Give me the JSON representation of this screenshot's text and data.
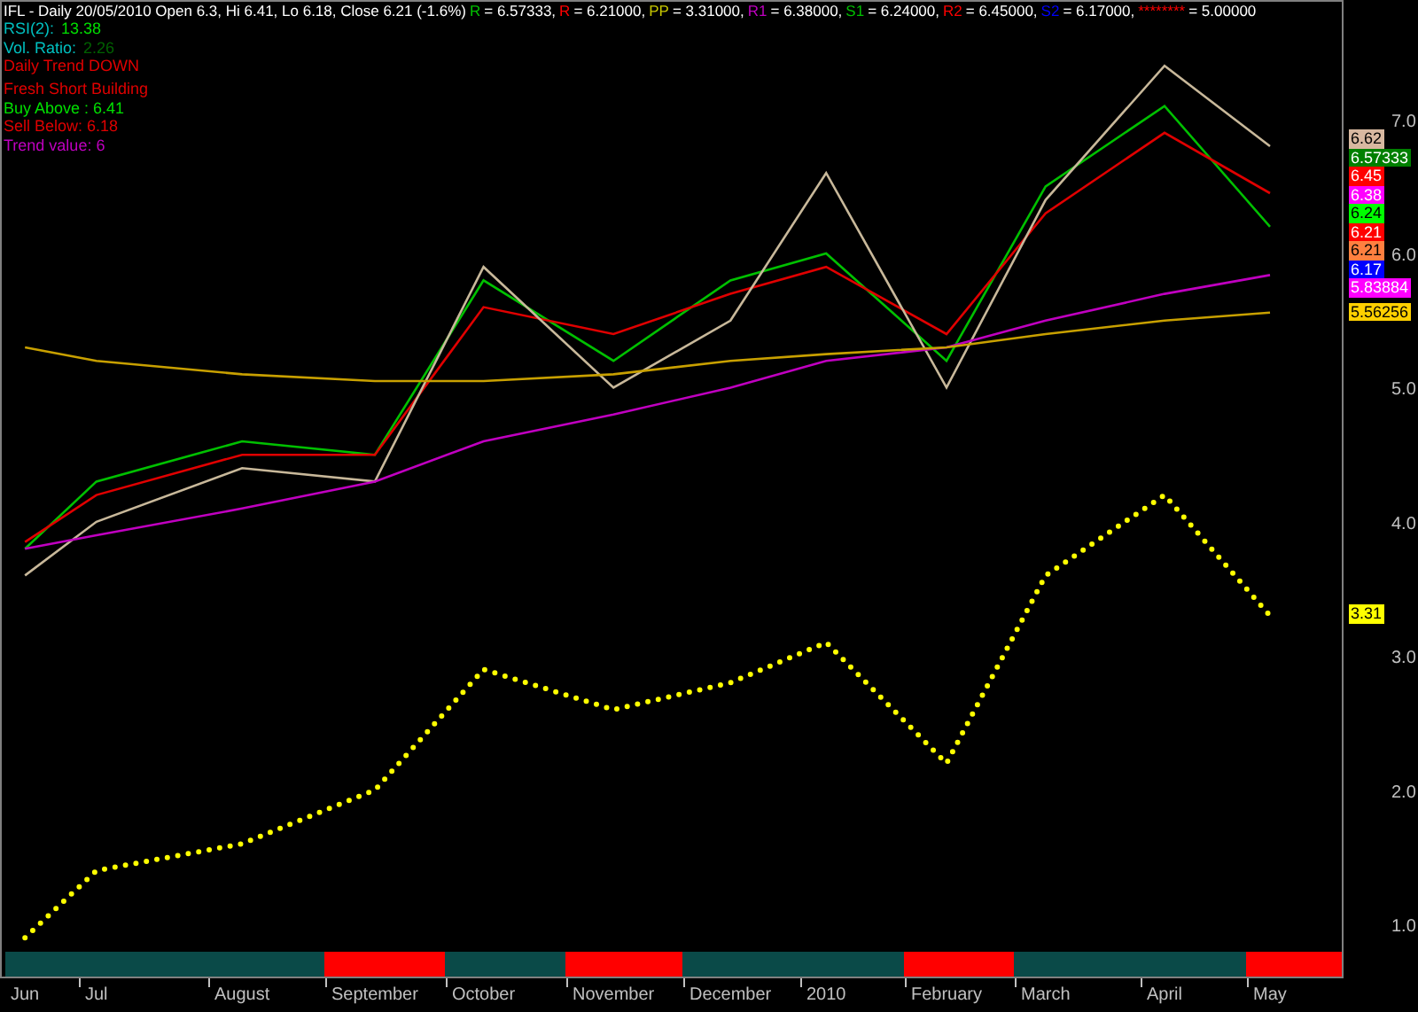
{
  "header": {
    "title": "IFL - Daily 20/05/2010 Open 6.3, Hi 6.41, Lo 6.18, Close 6.21 (-1.6%)",
    "levels": [
      {
        "label": "R",
        "value": "= 6.57333,",
        "color": "#00c000"
      },
      {
        "label": "R",
        "value": "= 6.21000,",
        "color": "#ff0000"
      },
      {
        "label": "PP",
        "value": "= 3.31000,",
        "color": "#c8c800"
      },
      {
        "label": "R1",
        "value": "= 6.38000,",
        "color": "#c000c0"
      },
      {
        "label": "S1",
        "value": "= 6.24000,",
        "color": "#00c000"
      },
      {
        "label": "R2",
        "value": "= 6.45000,",
        "color": "#ff0000"
      },
      {
        "label": "S2",
        "value": "= 6.17000,",
        "color": "#0000ff"
      },
      {
        "label": "********",
        "value": "= 5.00000",
        "color": "#ff0000"
      }
    ]
  },
  "info": [
    {
      "label": {
        "text": "RSI(2):",
        "color": "#00c0c0"
      },
      "value": {
        "text": "13.38",
        "color": "#00e000"
      }
    },
    {
      "label": {
        "text": "Vol. Ratio:",
        "color": "#00c0c0"
      },
      "value": {
        "text": "2.26",
        "color": "#006000"
      }
    },
    {
      "label": {
        "text": "Daily Trend DOWN",
        "color": "#e00000"
      }
    }
  ],
  "signals": [
    {
      "text": "Fresh Short Building",
      "color": "#e00000"
    },
    {
      "text": "Buy Above : 6.41",
      "color": "#00e000"
    },
    {
      "text": "Sell Below: 6.18",
      "color": "#e00000"
    },
    {
      "text": "Trend value: 6",
      "color": "#c000c0"
    }
  ],
  "price_tags": [
    {
      "text": "6.62",
      "color": "#d8b8a0"
    },
    {
      "text": "6.57333",
      "color": "#008000"
    },
    {
      "text": "6.45",
      "color": "#ff0000"
    },
    {
      "text": "6.38",
      "color": "#ff00ff"
    },
    {
      "text": "6.24",
      "color": "#00ff00"
    },
    {
      "text": "6.21",
      "color": "#ff0000"
    },
    {
      "text": "6.21",
      "color": "#ff8040"
    },
    {
      "text": "6.17",
      "color": "#0000ff"
    },
    {
      "text": "5.83884",
      "color": "#ff00ff"
    },
    {
      "text": "5.56256",
      "color": "#ffd000"
    },
    {
      "text": "3.31",
      "color": "#ffff00"
    }
  ],
  "trend_bar": [
    {
      "down": false
    },
    {
      "down": false
    },
    {
      "down": false
    },
    {
      "down": true
    },
    {
      "down": false
    },
    {
      "down": true
    },
    {
      "down": false
    },
    {
      "down": false
    },
    {
      "down": true
    },
    {
      "down": false
    },
    {
      "down": false
    },
    {
      "down": true
    }
  ],
  "chart_data": {
    "type": "line",
    "categories": [
      "Jun",
      "Jul",
      "August",
      "September",
      "October",
      "November",
      "December",
      "2010",
      "February",
      "March",
      "April",
      "May"
    ],
    "yticks": [
      {
        "value": 1,
        "label": "1.0"
      },
      {
        "value": 2,
        "label": "2.0"
      },
      {
        "value": 3,
        "label": "3.0"
      },
      {
        "value": 4,
        "label": "4.0"
      },
      {
        "value": 5,
        "label": "5.0"
      },
      {
        "value": 6,
        "label": "6.0"
      },
      {
        "value": 7,
        "label": "7.0"
      }
    ],
    "ylim": [
      0.61,
      7.89
    ],
    "series": [
      {
        "color": "#00c000",
        "values": [
          3.8,
          4.3,
          4.6,
          4.5,
          5.8,
          5.2,
          5.8,
          6.0,
          5.2,
          6.5,
          7.1,
          6.2
        ]
      },
      {
        "color": "#e00000",
        "values": [
          3.85,
          4.2,
          4.5,
          4.5,
          5.6,
          5.4,
          5.7,
          5.9,
          5.4,
          6.3,
          6.9,
          6.45
        ]
      },
      {
        "color": "#c8b89a",
        "values": [
          3.6,
          4.0,
          4.4,
          4.3,
          5.9,
          5.0,
          5.5,
          6.6,
          5.0,
          6.4,
          7.4,
          6.8
        ]
      },
      {
        "color": "#c000c0",
        "values": [
          3.8,
          3.9,
          4.1,
          4.3,
          4.6,
          4.8,
          5.0,
          5.2,
          5.3,
          5.5,
          5.7,
          5.84
        ]
      },
      {
        "color": "#c8a000",
        "values": [
          5.3,
          5.2,
          5.1,
          5.05,
          5.05,
          5.1,
          5.2,
          5.25,
          5.3,
          5.4,
          5.5,
          5.56
        ]
      },
      {
        "color": "#ffff00",
        "line_style": "dotted",
        "values": [
          0.9,
          1.4,
          1.6,
          2.0,
          2.9,
          2.6,
          2.8,
          3.1,
          2.2,
          3.6,
          4.2,
          3.3
        ]
      }
    ]
  }
}
